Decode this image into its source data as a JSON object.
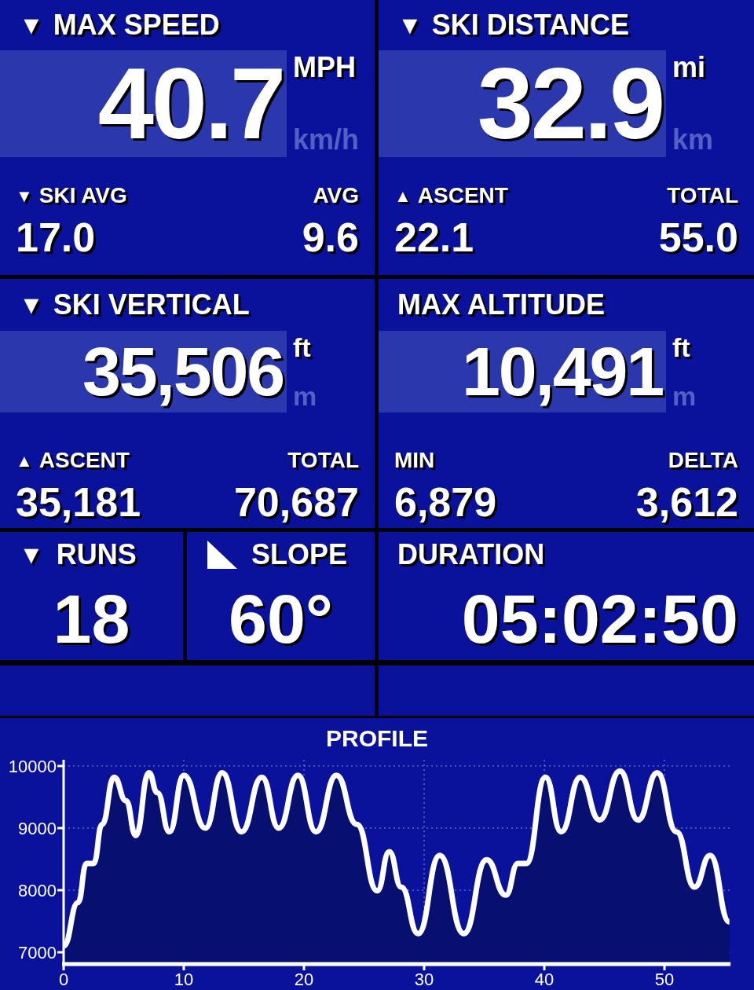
{
  "top_tiles": [
    {
      "arrow": "▼",
      "title": "MAX SPEED",
      "value": "40.7",
      "units": [
        {
          "label": "MPH",
          "selected": true
        },
        {
          "label": "km/h",
          "selected": false
        }
      ],
      "stats": [
        {
          "arrow": "▼",
          "label": "SKI AVG",
          "value": "17.0"
        },
        {
          "label": "AVG",
          "value": "9.6"
        }
      ]
    },
    {
      "arrow": "▼",
      "title": "SKI DISTANCE",
      "value": "32.9",
      "units": [
        {
          "label": "mi",
          "selected": true
        },
        {
          "label": "km",
          "selected": false
        }
      ],
      "stats": [
        {
          "arrow": "▲",
          "label": "ASCENT",
          "value": "22.1"
        },
        {
          "label": "TOTAL",
          "value": "55.0"
        }
      ]
    },
    {
      "arrow": "▼",
      "title": "SKI VERTICAL",
      "value": "35,506",
      "units": [
        {
          "label": "ft",
          "selected": true
        },
        {
          "label": "m",
          "selected": false
        }
      ],
      "stats": [
        {
          "arrow": "▲",
          "label": "ASCENT",
          "value": "35,181"
        },
        {
          "label": "TOTAL",
          "value": "70,687"
        }
      ]
    },
    {
      "title": "MAX ALTITUDE",
      "value": "10,491",
      "units": [
        {
          "label": "ft",
          "selected": true
        },
        {
          "label": "m",
          "selected": false
        }
      ],
      "stats": [
        {
          "label": "MIN",
          "value": "6,879"
        },
        {
          "label": "DELTA",
          "value": "3,612"
        }
      ]
    }
  ],
  "small_tiles": [
    {
      "kind": "arrow",
      "arrow": "▼",
      "title": "RUNS",
      "value": "18"
    },
    {
      "kind": "slope",
      "title": "SLOPE",
      "value": "60°"
    },
    {
      "kind": "plain",
      "title": "DURATION",
      "value": "05:02:50"
    }
  ],
  "profile": {
    "chart_data": {
      "type": "area",
      "title": "PROFILE",
      "x": [
        0,
        1.2,
        1.9,
        2.5,
        3.2,
        4.2,
        5.2,
        6,
        7.1,
        7.8,
        8.8,
        10,
        11.8,
        13.2,
        14.8,
        16.5,
        17.9,
        19.5,
        21,
        22.7,
        24.4,
        26.1,
        27.1,
        28.1,
        29.5,
        31.3,
        33.3,
        35.2,
        36.8,
        37.8,
        38.5,
        40.1,
        41.4,
        43,
        44.6,
        46.3,
        47.8,
        49.4,
        51,
        52.5,
        53.8,
        55.4
      ],
      "series": [
        {
          "color": "#ffffff",
          "values": [
            7100,
            7800,
            8430,
            8430,
            9060,
            9820,
            9440,
            8880,
            9890,
            9570,
            8940,
            9850,
            9000,
            9890,
            8940,
            9820,
            9000,
            9850,
            8940,
            9850,
            9060,
            7990,
            8620,
            8050,
            7300,
            8560,
            7300,
            8490,
            7920,
            8430,
            8430,
            9820,
            8940,
            9820,
            9130,
            9920,
            9130,
            9890,
            8940,
            8050,
            8560,
            7490
          ]
        }
      ],
      "xlim": [
        0,
        55.5
      ],
      "ylim": [
        6810,
        10100
      ],
      "grid": true,
      "xticks": [
        0,
        10,
        20,
        30,
        40,
        50
      ],
      "yticks": [
        7000,
        8000,
        9000,
        10000
      ]
    }
  }
}
